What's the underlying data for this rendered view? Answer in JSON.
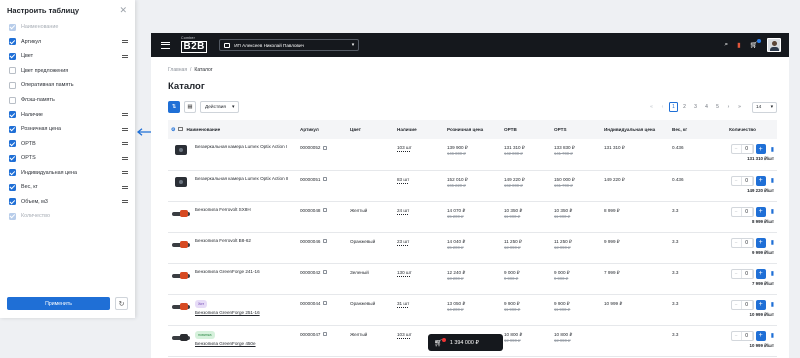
{
  "panel": {
    "title": "Настроить таблицу",
    "apply_label": "Применить",
    "columns": [
      {
        "label": "Наименование",
        "state": "disabled"
      },
      {
        "label": "Артикул",
        "state": "on"
      },
      {
        "label": "Цвет",
        "state": "on"
      },
      {
        "label": "Цвет предложения",
        "state": "off"
      },
      {
        "label": "Оперативная память",
        "state": "off"
      },
      {
        "label": "Флэш-память",
        "state": "off"
      },
      {
        "label": "Наличие",
        "state": "on"
      },
      {
        "label": "Розничная цена",
        "state": "on"
      },
      {
        "label": "OPTB",
        "state": "on"
      },
      {
        "label": "OPTS",
        "state": "on"
      },
      {
        "label": "Индивидуальная цена",
        "state": "on"
      },
      {
        "label": "Вес, кг",
        "state": "on"
      },
      {
        "label": "Объем, м3",
        "state": "on"
      },
      {
        "label": "Количество",
        "state": "disabled"
      }
    ]
  },
  "topbar": {
    "logo_top": "Сomber",
    "logo_main": "B2B",
    "company": "ИП Алексеев Николай Павлович"
  },
  "breadcrumb": {
    "home": "Главная",
    "sep": "/",
    "current": "Каталог"
  },
  "page_title": "Каталог",
  "toolbar": {
    "actions_label": "Действия",
    "pages": [
      "1",
      "2",
      "3",
      "4",
      "5"
    ],
    "current_page": "1",
    "per_page": "14"
  },
  "table": {
    "headers": [
      "Наименование",
      "Артикул",
      "Цвет",
      "Наличие",
      "Розничная цена",
      "OPTB",
      "OPTS",
      "Индивидуальная цена",
      "Вес, кг",
      "Количество"
    ],
    "rows": [
      {
        "thumb": "cam",
        "badge": "",
        "name": "Беззеркальная камера Lumex Optix Action I",
        "article": "00000052",
        "color": "",
        "stock": "103 шт",
        "retail": "139 900 ₽",
        "retail_old": "146 000 ₽",
        "optb": "131 310 ₽",
        "optb_old": "142 000 ₽",
        "opts": "133 830 ₽",
        "opts_old": "141 700 ₽",
        "individual": "131 310 ₽",
        "weight": "0.436",
        "qty": "0",
        "sum": "131 310 ₽/шт"
      },
      {
        "thumb": "cam",
        "badge": "",
        "name": "Беззеркальная камера Lumex Optix Action II",
        "article": "00000051",
        "color": "",
        "stock": "83 шт",
        "retail": "152 010 ₽",
        "retail_old": "165 220 ₽",
        "optb": "149 220 ₽",
        "optb_old": "162 000 ₽",
        "opts": "150 000 ₽",
        "opts_old": "161 700 ₽",
        "individual": "149 220 ₽",
        "weight": "0.436",
        "qty": "0",
        "sum": "149 220 ₽/шт"
      },
      {
        "thumb": "saw",
        "badge": "",
        "name": "Бензопила Ferrovolt SX8H",
        "article": "00000048",
        "color": "Желтый",
        "stock": "24 шт",
        "retail": "14 070 ₽",
        "retail_old": "15 200 ₽",
        "optb": "10 350 ₽",
        "optb_old": "11 990 ₽",
        "opts": "10 350 ₽",
        "opts_old": "11 990 ₽",
        "individual": "8 999 ₽",
        "weight": "3.3",
        "qty": "0",
        "sum": "8 999 ₽/шт"
      },
      {
        "thumb": "saw",
        "badge": "",
        "name": "Бензопила Ferrovolt B8-62",
        "article": "00000046",
        "color": "Оранжевый",
        "stock": "23 шт",
        "retail": "14 040 ₽",
        "retail_old": "15 200 ₽",
        "optb": "11 250 ₽",
        "optb_old": "12 990 ₽",
        "opts": "11 250 ₽",
        "opts_old": "12 990 ₽",
        "individual": "9 999 ₽",
        "weight": "3.3",
        "qty": "0",
        "sum": "9 999 ₽/шт"
      },
      {
        "thumb": "saw",
        "badge": "",
        "name": "Бензопила GreenForge 241-16",
        "article": "00000042",
        "color": "Зеленый",
        "stock": "130 шт",
        "retail": "12 240 ₽",
        "retail_old": "13 200 ₽",
        "optb": "9 000 ₽",
        "optb_old": "9 990 ₽",
        "opts": "9 000 ₽",
        "opts_old": "9 990 ₽",
        "individual": "7 999 ₽",
        "weight": "3.3",
        "qty": "0",
        "sum": "7 999 ₽/шт"
      },
      {
        "thumb": "saw",
        "badge": "Хит",
        "badge_kind": "sale",
        "name": "Бензопила GreenForge 251-16",
        "article": "00000044",
        "color": "Оранжевый",
        "stock": "31 шт",
        "retail": "13 050 ₽",
        "retail_old": "14 200 ₽",
        "optb": "9 900 ₽",
        "optb_old": "11 990 ₽",
        "opts": "9 900 ₽",
        "opts_old": "11 990 ₽",
        "individual": "10 999 ₽",
        "weight": "3.3",
        "qty": "0",
        "sum": "10 999 ₽/шт"
      },
      {
        "thumb": "saw blk",
        "badge": "новинка",
        "badge_kind": "new",
        "name": "Бензопила GreenForge 450e",
        "article": "00000047",
        "color": "Желтый",
        "stock": "103 шт",
        "retail": "",
        "retail_old": "",
        "optb": "10 800 ₽",
        "optb_old": "12 990 ₽",
        "opts": "10 800 ₽",
        "opts_old": "12 990 ₽",
        "individual": "",
        "weight": "3.3",
        "qty": "0",
        "sum": "10 999 ₽/шт"
      }
    ]
  },
  "floating_cart": {
    "total": "1 394 000 ₽"
  },
  "colors": {
    "accent": "#1f6fd6",
    "topbar": "#15181d"
  }
}
